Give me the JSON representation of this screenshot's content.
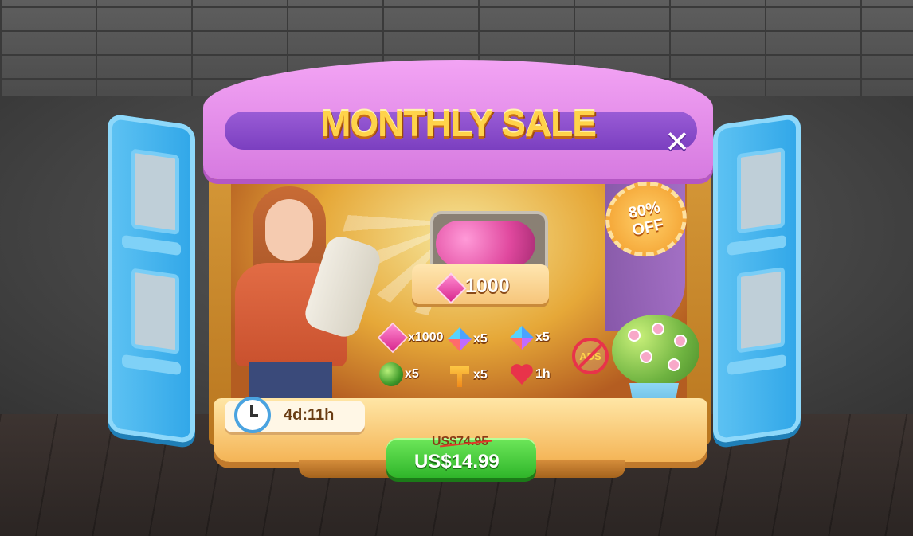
{
  "title": "MONTHLY SALE",
  "close_label": "✕",
  "badge": "80%\nOFF",
  "featured_amount": "1000",
  "rewards": [
    {
      "icon": "gem-icon",
      "qty": "x1000"
    },
    {
      "icon": "rocket-icon",
      "qty": "x5"
    },
    {
      "icon": "rocket-icon",
      "qty": "x5"
    },
    {
      "icon": "bomb-icon",
      "qty": "x5"
    },
    {
      "icon": "hammer-icon",
      "qty": "x5"
    },
    {
      "icon": "heart-icon",
      "qty": "1h"
    }
  ],
  "no_ads_label": "ADS",
  "timer": "4d:11h",
  "price": {
    "original": "US$74.95",
    "sale": "US$14.99"
  },
  "colors": {
    "roof": "#e28fe8",
    "button": "#3fc736",
    "title": "#ffd34a"
  }
}
